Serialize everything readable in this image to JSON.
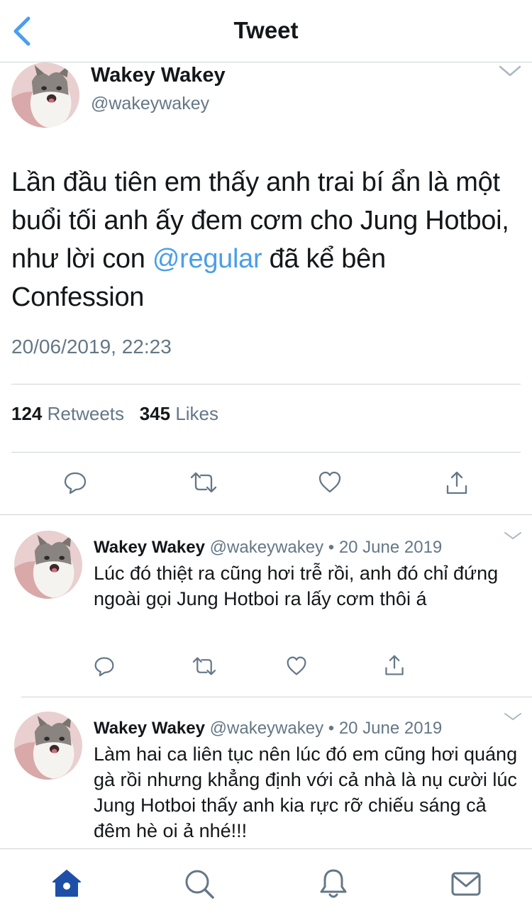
{
  "header": {
    "title": "Tweet",
    "back_icon": "chevron-left-icon"
  },
  "main_tweet": {
    "name": "Wakey Wakey",
    "handle": "@wakeywakey",
    "text_before": "Lần đầu tiên em thấy anh trai bí ẩn là một buổi tối anh ấy đem cơm cho Jung Hotboi, như lời con ",
    "mention": "@regular",
    "text_after": " đã kể bên Confession",
    "timestamp": "20/06/2019, 22:23",
    "retweets_count": "124",
    "retweets_label": "Retweets",
    "likes_count": "345",
    "likes_label": "Likes",
    "actions": [
      "reply-icon",
      "retweet-icon",
      "like-icon",
      "share-icon"
    ]
  },
  "replies": [
    {
      "name": "Wakey Wakey",
      "meta": "@wakeywakey • 20 June 2019",
      "text": "Lúc đó thiệt ra cũng hơi trễ rồi, anh đó chỉ đứng ngoài gọi Jung Hotboi ra lấy cơm thôi á"
    },
    {
      "name": "Wakey Wakey",
      "meta": "@wakeywakey • 20 June 2019",
      "text": "Làm hai ca liên tục nên lúc đó em cũng hơi quáng gà rồi nhưng khẳng định với cả nhà là nụ cười lúc Jung Hotboi thấy anh kia rực rỡ chiếu sáng cả đêm hè oi ả nhé!!!"
    }
  ],
  "tabbar": [
    "home-icon",
    "search-icon",
    "notifications-icon",
    "messages-icon"
  ],
  "colors": {
    "accent": "#1da1f2",
    "link": "#4a9fe8",
    "text": "#14171a",
    "muted": "#657786",
    "tab_active": "#1e4fa8"
  }
}
